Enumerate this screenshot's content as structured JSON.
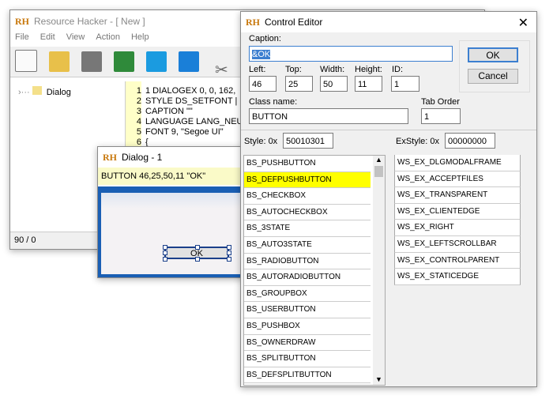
{
  "main": {
    "title": "Resource Hacker - [ New ]",
    "menu": [
      "File",
      "Edit",
      "View",
      "Action",
      "Help"
    ],
    "tree_item": "Dialog",
    "status": "90 / 0",
    "code": [
      {
        "n": "1",
        "t": "1 DIALOGEX 0, 0, 162,"
      },
      {
        "n": "2",
        "t": "STYLE DS_SETFONT |"
      },
      {
        "n": "3",
        "t": "CAPTION \"\""
      },
      {
        "n": "4",
        "t": "LANGUAGE LANG_NEUT"
      },
      {
        "n": "5",
        "t": "FONT 9, \"Segoe UI\""
      },
      {
        "n": "6",
        "t": "{"
      }
    ]
  },
  "dialog": {
    "title": "Dialog - 1",
    "info": "BUTTON  46,25,50,11  \"OK\"",
    "button": "OK"
  },
  "editor": {
    "title": "Control Editor",
    "caption_label": "Caption:",
    "caption": "&OK",
    "left_label": "Left:",
    "left": "46",
    "top_label": "Top:",
    "top": "25",
    "width_label": "Width:",
    "width": "50",
    "height_label": "Height:",
    "height": "11",
    "id_label": "ID:",
    "id": "1",
    "class_label": "Class name:",
    "class": "BUTTON",
    "tab_label": "Tab Order",
    "tab": "1",
    "ok": "OK",
    "cancel": "Cancel",
    "style_label": "Style:  0x",
    "style": "50010301",
    "exstyle_label": "ExStyle:  0x",
    "exstyle": "00000000",
    "styles": [
      "BS_PUSHBUTTON",
      "BS_DEFPUSHBUTTON",
      "BS_CHECKBOX",
      "BS_AUTOCHECKBOX",
      "BS_3STATE",
      "BS_AUTO3STATE",
      "BS_RADIOBUTTON",
      "BS_AUTORADIOBUTTON",
      "BS_GROUPBOX",
      "BS_USERBUTTON",
      "BS_PUSHBOX",
      "BS_OWNERDRAW",
      "BS_SPLITBUTTON",
      "BS_DEFSPLITBUTTON"
    ],
    "selected_style": 1,
    "exstyles": [
      "WS_EX_DLGMODALFRAME",
      "WS_EX_ACCEPTFILES",
      "WS_EX_TRANSPARENT",
      "WS_EX_CLIENTEDGE",
      "WS_EX_RIGHT",
      "WS_EX_LEFTSCROLLBAR",
      "WS_EX_CONTROLPARENT",
      "WS_EX_STATICEDGE"
    ]
  }
}
